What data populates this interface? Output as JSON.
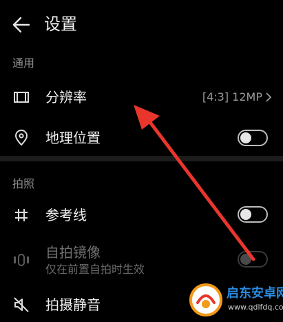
{
  "header": {
    "title": "设置",
    "back_icon": "arrow-left-icon"
  },
  "sections": {
    "general": {
      "label": "通用",
      "resolution": {
        "label": "分辨率",
        "value": "[4:3] 12MP",
        "icon": "film-frame-icon"
      },
      "location": {
        "label": "地理位置",
        "icon": "location-pin-icon",
        "toggle": "off"
      }
    },
    "photo": {
      "label": "拍照",
      "gridlines": {
        "label": "参考线",
        "icon": "grid-hash-icon",
        "toggle": "off"
      },
      "mirror": {
        "label": "自拍镜像",
        "sublabel": "仅在前置自拍时生效",
        "icon": "mirror-icon",
        "toggle": "off",
        "enabled": false
      },
      "mute": {
        "label": "拍摄静音",
        "icon": "speaker-mute-icon"
      }
    }
  },
  "annotation": {
    "type": "red-arrow",
    "color": "#e8362d"
  },
  "watermark": {
    "name": "启东安卓网",
    "url": "www.qdlfdq.com"
  },
  "colors": {
    "background": "#000000",
    "text": "#eeeeee",
    "muted": "#8c8c8c",
    "arrow": "#e8362d",
    "brand": "#2b8be0"
  }
}
